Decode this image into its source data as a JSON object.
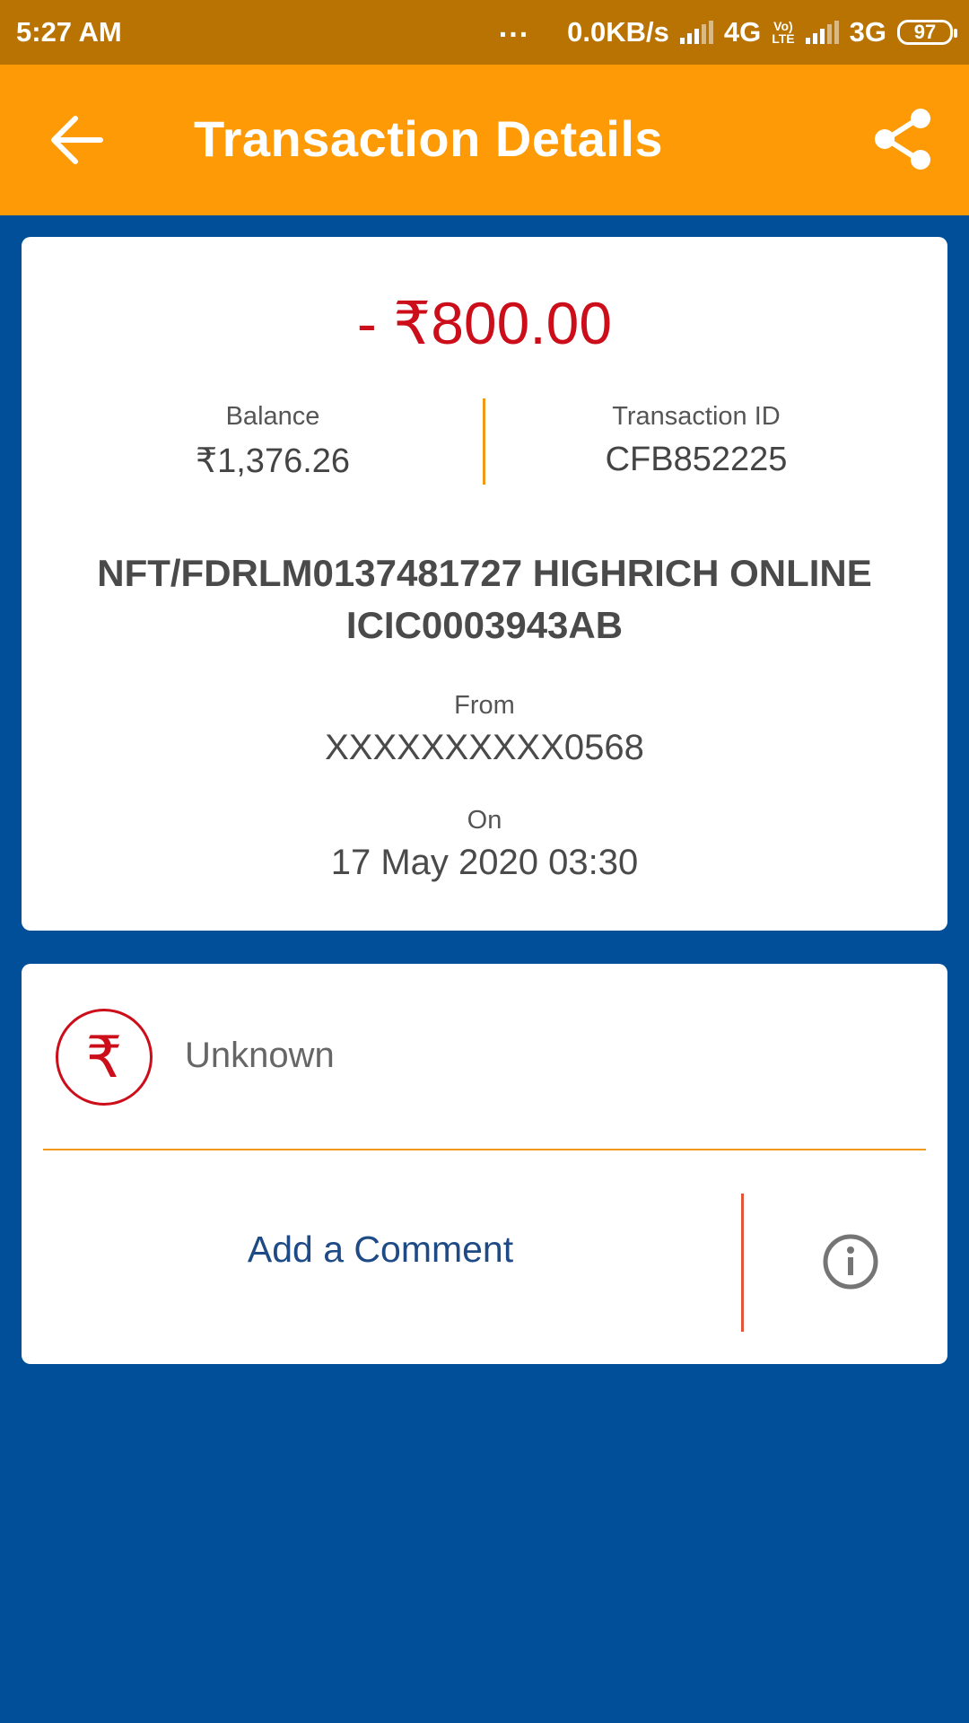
{
  "status_bar": {
    "time": "5:27 AM",
    "dots": "...",
    "speed": "0.0KB/s",
    "network1": "4G",
    "lte_top": "Vo)",
    "lte_bottom": "LTE",
    "network2": "3G",
    "battery": "97"
  },
  "app_bar": {
    "title": "Transaction Details"
  },
  "transaction": {
    "amount": "- ₹800.00",
    "balance_label": "Balance",
    "balance_value": "₹1,376.26",
    "txn_id_label": "Transaction ID",
    "txn_id_value": "CFB852225",
    "description": "NFT/FDRLM0137481727 HIGHRICH ONLINE ICIC0003943AB",
    "from_label": "From",
    "from_value": "XXXXXXXXXX0568",
    "on_label": "On",
    "on_value": "17 May 2020 03:30"
  },
  "category": {
    "icon_glyph": "₹",
    "label": "Unknown"
  },
  "comment": {
    "label": "Add a Comment"
  },
  "colors": {
    "background": "#024f99",
    "app_bar": "#fd9a05",
    "status_bar": "#b87303",
    "amount": "#cc0e1a",
    "accent": "#f29a17"
  }
}
